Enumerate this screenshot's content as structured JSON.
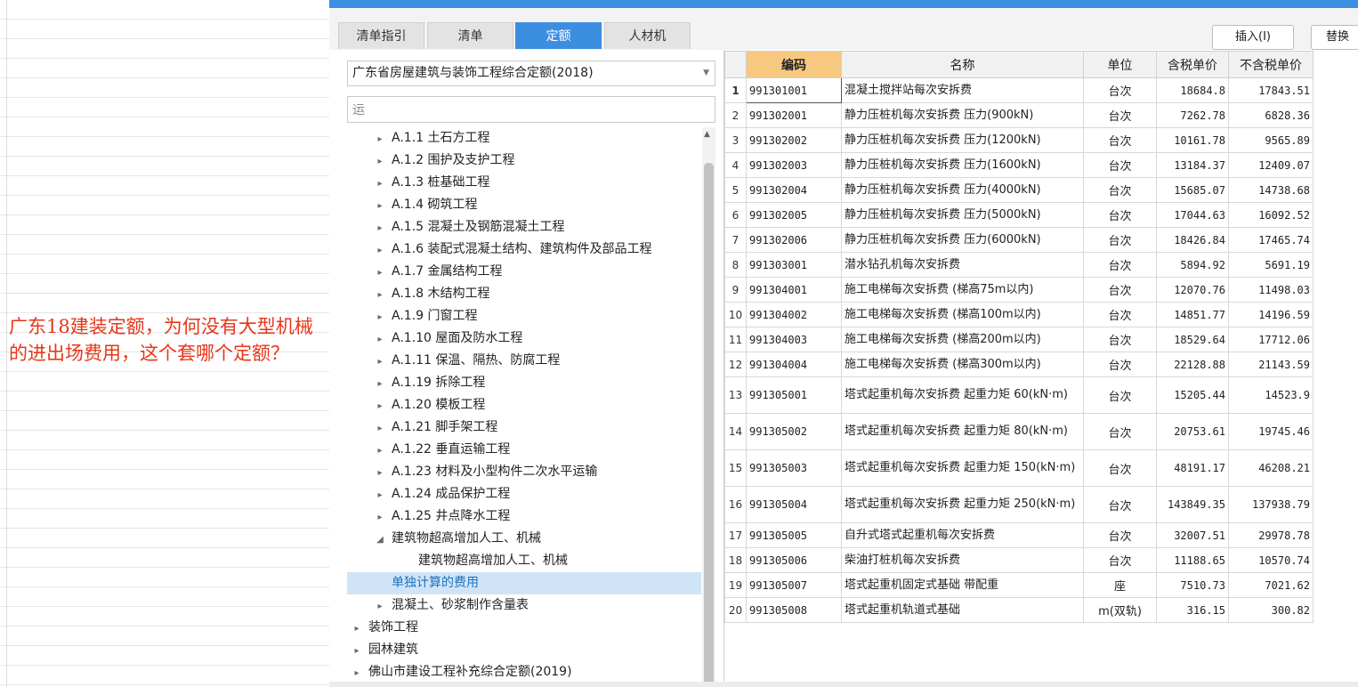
{
  "question": "广东18建装定额，为何没有大型机械的进出场费用，这个套哪个定额？",
  "tabs": [
    {
      "label": "清单指引",
      "active": false
    },
    {
      "label": "清单",
      "active": false
    },
    {
      "label": "定额",
      "active": true
    },
    {
      "label": "人材机",
      "active": false
    }
  ],
  "toolbar": {
    "insert": "插入(I)",
    "replace": "替换"
  },
  "library_select": "广东省房屋建筑与装饰工程综合定额(2018)",
  "search": {
    "value": "运"
  },
  "tree": [
    {
      "label": "A.1.1 土石方工程",
      "level": 1,
      "arrow": "▸"
    },
    {
      "label": "A.1.2 围护及支护工程",
      "level": 1,
      "arrow": "▸"
    },
    {
      "label": "A.1.3 桩基础工程",
      "level": 1,
      "arrow": "▸"
    },
    {
      "label": "A.1.4 砌筑工程",
      "level": 1,
      "arrow": "▸"
    },
    {
      "label": "A.1.5 混凝土及钢筋混凝土工程",
      "level": 1,
      "arrow": "▸"
    },
    {
      "label": "A.1.6 装配式混凝土结构、建筑构件及部品工程",
      "level": 1,
      "arrow": "▸"
    },
    {
      "label": "A.1.7 金属结构工程",
      "level": 1,
      "arrow": "▸"
    },
    {
      "label": "A.1.8 木结构工程",
      "level": 1,
      "arrow": "▸"
    },
    {
      "label": "A.1.9 门窗工程",
      "level": 1,
      "arrow": "▸"
    },
    {
      "label": "A.1.10 屋面及防水工程",
      "level": 1,
      "arrow": "▸"
    },
    {
      "label": "A.1.11 保温、隔热、防腐工程",
      "level": 1,
      "arrow": "▸"
    },
    {
      "label": "A.1.19 拆除工程",
      "level": 1,
      "arrow": "▸"
    },
    {
      "label": "A.1.20 模板工程",
      "level": 1,
      "arrow": "▸"
    },
    {
      "label": "A.1.21 脚手架工程",
      "level": 1,
      "arrow": "▸"
    },
    {
      "label": "A.1.22 垂直运输工程",
      "level": 1,
      "arrow": "▸"
    },
    {
      "label": "A.1.23 材料及小型构件二次水平运输",
      "level": 1,
      "arrow": "▸"
    },
    {
      "label": "A.1.24 成品保护工程",
      "level": 1,
      "arrow": "▸"
    },
    {
      "label": "A.1.25 井点降水工程",
      "level": 1,
      "arrow": "▸"
    },
    {
      "label": "建筑物超高增加人工、机械",
      "level": 1,
      "arrow": "◢"
    },
    {
      "label": "建筑物超高增加人工、机械",
      "level": 2,
      "arrow": ""
    },
    {
      "label": "单独计算的费用",
      "level": 1,
      "arrow": "",
      "selected": true
    },
    {
      "label": "混凝土、砂浆制作含量表",
      "level": 1,
      "arrow": "▸"
    },
    {
      "label": "装饰工程",
      "level": 0,
      "arrow": "▸"
    },
    {
      "label": "园林建筑",
      "level": 0,
      "arrow": "▸"
    },
    {
      "label": "佛山市建设工程补充综合定额(2019)",
      "level": 0,
      "arrow": "▸"
    }
  ],
  "grid": {
    "headers": [
      "",
      "编码",
      "名称",
      "单位",
      "含税单价",
      "不含税单价"
    ],
    "rows": [
      {
        "no": "1",
        "code": "991301001",
        "name": "混凝土搅拌站每次安拆费",
        "unit": "台次",
        "tax": "18684.8",
        "notax": "17843.51"
      },
      {
        "no": "2",
        "code": "991302001",
        "name": "静力压桩机每次安拆费 压力(900kN)",
        "unit": "台次",
        "tax": "7262.78",
        "notax": "6828.36"
      },
      {
        "no": "3",
        "code": "991302002",
        "name": "静力压桩机每次安拆费 压力(1200kN)",
        "unit": "台次",
        "tax": "10161.78",
        "notax": "9565.89"
      },
      {
        "no": "4",
        "code": "991302003",
        "name": "静力压桩机每次安拆费 压力(1600kN)",
        "unit": "台次",
        "tax": "13184.37",
        "notax": "12409.07"
      },
      {
        "no": "5",
        "code": "991302004",
        "name": "静力压桩机每次安拆费 压力(4000kN)",
        "unit": "台次",
        "tax": "15685.07",
        "notax": "14738.68"
      },
      {
        "no": "6",
        "code": "991302005",
        "name": "静力压桩机每次安拆费 压力(5000kN)",
        "unit": "台次",
        "tax": "17044.63",
        "notax": "16092.52"
      },
      {
        "no": "7",
        "code": "991302006",
        "name": "静力压桩机每次安拆费 压力(6000kN)",
        "unit": "台次",
        "tax": "18426.84",
        "notax": "17465.74"
      },
      {
        "no": "8",
        "code": "991303001",
        "name": "潜水钻孔机每次安拆费",
        "unit": "台次",
        "tax": "5894.92",
        "notax": "5691.19"
      },
      {
        "no": "9",
        "code": "991304001",
        "name": "施工电梯每次安拆费 (梯高75m以内)",
        "unit": "台次",
        "tax": "12070.76",
        "notax": "11498.03"
      },
      {
        "no": "10",
        "code": "991304002",
        "name": "施工电梯每次安拆费 (梯高100m以内)",
        "unit": "台次",
        "tax": "14851.77",
        "notax": "14196.59"
      },
      {
        "no": "11",
        "code": "991304003",
        "name": "施工电梯每次安拆费 (梯高200m以内)",
        "unit": "台次",
        "tax": "18529.64",
        "notax": "17712.06"
      },
      {
        "no": "12",
        "code": "991304004",
        "name": "施工电梯每次安拆费 (梯高300m以内)",
        "unit": "台次",
        "tax": "22128.88",
        "notax": "21143.59"
      },
      {
        "no": "13",
        "code": "991305001",
        "name": "塔式起重机每次安拆费 起重力矩 60(kN·m)",
        "unit": "台次",
        "tax": "15205.44",
        "notax": "14523.9",
        "tall": true
      },
      {
        "no": "14",
        "code": "991305002",
        "name": "塔式起重机每次安拆费 起重力矩 80(kN·m)",
        "unit": "台次",
        "tax": "20753.61",
        "notax": "19745.46",
        "tall": true
      },
      {
        "no": "15",
        "code": "991305003",
        "name": "塔式起重机每次安拆费 起重力矩 150(kN·m)",
        "unit": "台次",
        "tax": "48191.17",
        "notax": "46208.21",
        "tall": true
      },
      {
        "no": "16",
        "code": "991305004",
        "name": "塔式起重机每次安拆费 起重力矩 250(kN·m)",
        "unit": "台次",
        "tax": "143849.35",
        "notax": "137938.79",
        "tall": true
      },
      {
        "no": "17",
        "code": "991305005",
        "name": "自升式塔式起重机每次安拆费",
        "unit": "台次",
        "tax": "32007.51",
        "notax": "29978.78"
      },
      {
        "no": "18",
        "code": "991305006",
        "name": "柴油打桩机每次安拆费",
        "unit": "台次",
        "tax": "11188.65",
        "notax": "10570.74"
      },
      {
        "no": "19",
        "code": "991305007",
        "name": "塔式起重机固定式基础 带配重",
        "unit": "座",
        "tax": "7510.73",
        "notax": "7021.62"
      },
      {
        "no": "20",
        "code": "991305008",
        "name": "塔式起重机轨道式基础",
        "unit": "m(双轨)",
        "tax": "316.15",
        "notax": "300.82"
      }
    ]
  }
}
